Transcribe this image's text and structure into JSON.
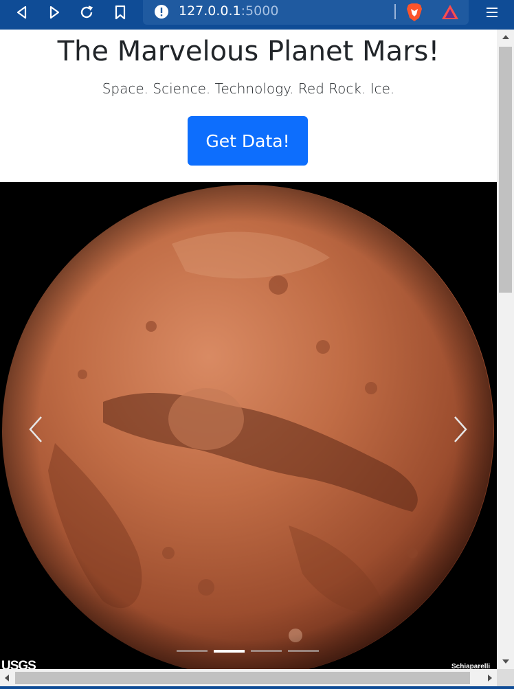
{
  "browser": {
    "url_host": "127.0.0.1",
    "url_port": ":5000",
    "icons": [
      "back-icon",
      "forward-icon",
      "reload-icon",
      "bookmark-icon",
      "site-info-icon",
      "brave-shield-icon",
      "brave-rewards-icon",
      "menu-icon"
    ],
    "accent": "#0f4c96"
  },
  "page": {
    "title": "The Marvelous Planet Mars!",
    "tagline": "Space. Science. Technology. Red Rock. Ice.",
    "get_data_label": "Get Data!",
    "button_color": "#0d6efd"
  },
  "carousel": {
    "indicator_count": 4,
    "active_index": 1,
    "credit_left": "USGS",
    "credit_right": "Schiaparelli",
    "prev_icon": "chevron-left-icon",
    "next_icon": "chevron-right-icon"
  }
}
